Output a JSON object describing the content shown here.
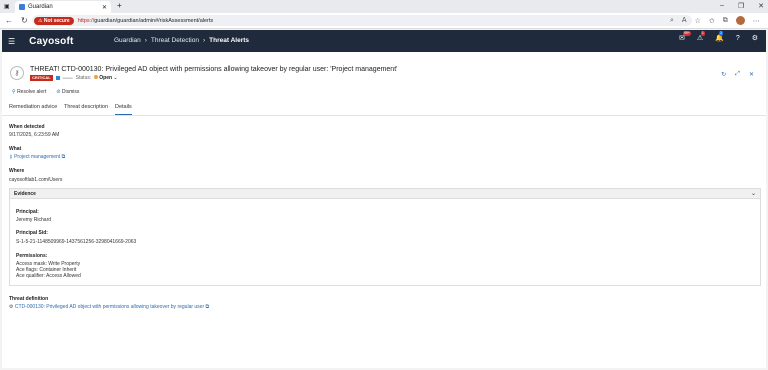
{
  "browser": {
    "tab_title": "Guardian",
    "not_secure": "Not secure",
    "url_prefix": "https://",
    "url_rest": "guardian/guardian/admin#/riskAssessment/alerts"
  },
  "app": {
    "logo": "Cayosoft",
    "crumb1": "Guardian",
    "crumb2": "Threat Detection",
    "crumb3": "Threat Alerts",
    "badge1": "99+",
    "badge2": "1",
    "badge3": "2"
  },
  "alert": {
    "title": "THREAT! CTD-000130: Privileged AD object with permissions allowing takeover by regular user: 'Project management'",
    "severity": "CRITICAL",
    "status_label": "Status:",
    "status_value": "Open"
  },
  "actions": {
    "resolve": "Resolve alert",
    "dismiss": "Dismiss"
  },
  "tabs": [
    "Remediation advice",
    "Threat description",
    "Details"
  ],
  "details": {
    "when_label": "When detected",
    "when_value": "9/17/2025, 6:23:59 AM",
    "what_label": "What",
    "what_value": "Project management",
    "where_label": "Where",
    "where_value": "cayosoftlab1.com/Users",
    "evidence_label": "Evidence",
    "principal_label": "Principal:",
    "principal_value": "Jeremy Richard",
    "sid_label": "Principal Sid:",
    "sid_value": "S-1-5-21-1148509969-1437561256-3298041669-2063",
    "perm_label": "Permissions:",
    "perm1": "Access mask: Write Property",
    "perm2": "Ace flags: Container Inherit",
    "perm3": "Ace qualifier: Access Allowed",
    "def_label": "Threat definition",
    "def_value": "CTD-000130: Privileged AD object with permissions allowing takeover by regular user"
  }
}
